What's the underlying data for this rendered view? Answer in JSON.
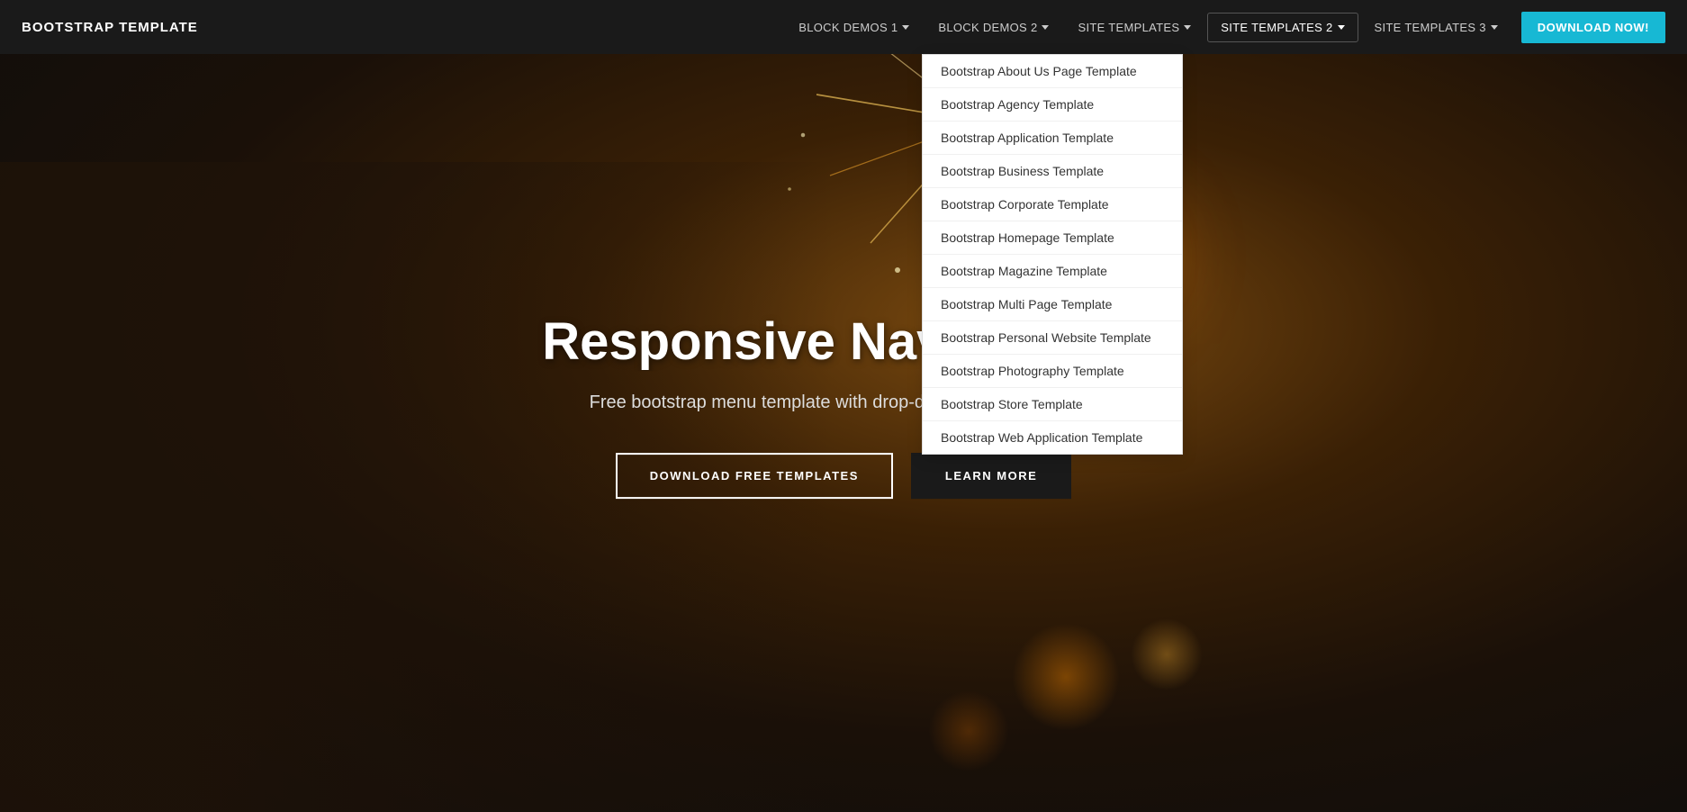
{
  "brand": "BOOTSTRAP TEMPLATE",
  "nav": {
    "items": [
      {
        "id": "block-demos-1",
        "label": "BLOCK DEMOS 1",
        "has_caret": true,
        "active": false
      },
      {
        "id": "block-demos-2",
        "label": "BLOCK DEMOS 2",
        "has_caret": true,
        "active": false
      },
      {
        "id": "site-templates",
        "label": "SITE TEMPLATES",
        "has_caret": true,
        "active": false
      },
      {
        "id": "site-templates-2",
        "label": "SITE TEMPLATES 2",
        "has_caret": true,
        "active": true
      },
      {
        "id": "site-templates-3",
        "label": "SITE TEMPLATES 3",
        "has_caret": true,
        "active": false
      }
    ],
    "download_btn": "DOWNLOAD NOW!"
  },
  "dropdown": {
    "items": [
      "Bootstrap About Us Page Template",
      "Bootstrap Agency Template",
      "Bootstrap Application Template",
      "Bootstrap Business Template",
      "Bootstrap Corporate Template",
      "Bootstrap Homepage Template",
      "Bootstrap Magazine Template",
      "Bootstrap Multi Page Template",
      "Bootstrap Personal Website Template",
      "Bootstrap Photography Template",
      "Bootstrap Store Template",
      "Bootstrap Web Application Template"
    ]
  },
  "hero": {
    "title": "Responsive Navbar Tem",
    "subtitle": "Free bootstrap menu template with drop-down lists and buttons.",
    "btn_download": "DOWNLOAD FREE TEMPLATES",
    "btn_learn": "LEARN MORE"
  }
}
